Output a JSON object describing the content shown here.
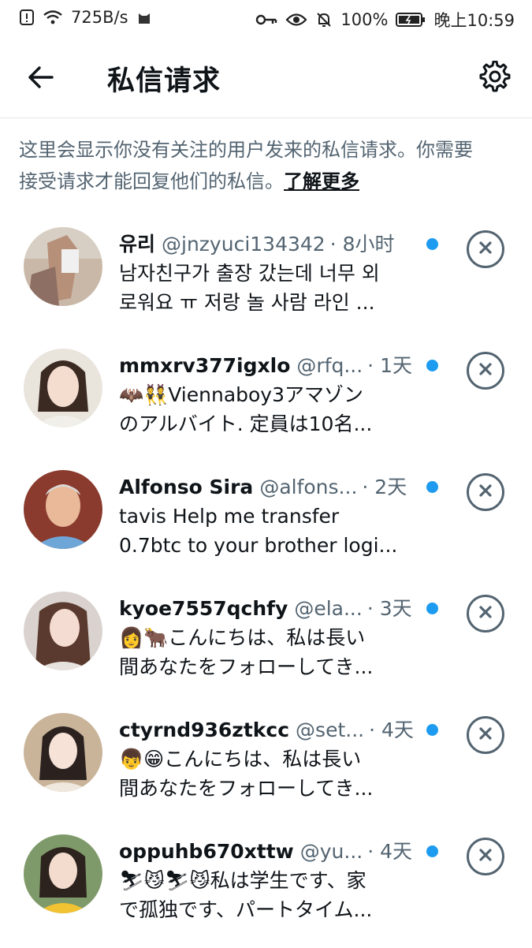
{
  "status_bar": {
    "net_speed": "725B/s",
    "battery": "100%",
    "time": "晚上10:59",
    "icons_left": [
      "alert-icon",
      "wifi-icon",
      "cat-app-icon"
    ],
    "icons_right": [
      "key-icon",
      "eye-icon",
      "mute-bell-icon",
      "battery-icon"
    ]
  },
  "header": {
    "title": "私信请求",
    "back_icon": "arrow-left-icon",
    "settings_icon": "gear-icon"
  },
  "notice": {
    "line1": "这里会显示你没有关注的用户发来的私信请求。你需要",
    "line2_text": "接受请求才能回复他们的私信。",
    "learn_more": "了解更多"
  },
  "colors": {
    "accent": "#1d9bf0",
    "secondary_text": "#536471",
    "primary_text": "#0f1419"
  },
  "requests": [
    {
      "name": "유리",
      "handle": "@jnzyuci134342",
      "time": "· 8小时",
      "line1": "남자친구가 출장 갔는데 너무 외",
      "line2": "로워요 ㅠ 저랑 놀 사람 라인 ...",
      "unread": true
    },
    {
      "name": "mmxrv377igxlo",
      "handle": "@rfq...",
      "time": "· 1天",
      "line1": "🦇👯Viennaboy3アマゾン",
      "line2": "のアルバイト. 定員は10名...",
      "unread": true
    },
    {
      "name": "Alfonso Sira",
      "handle": "@alfons...",
      "time": "· 2天",
      "line1": "tavis Help me transfer",
      "line2": "0.7btc to your brother logi...",
      "unread": true
    },
    {
      "name": "kyoe7557qchfy",
      "handle": "@ela...",
      "time": "· 3天",
      "line1": "👩🐂こんにちは、私は長い",
      "line2": "間あなたをフォローしてき...",
      "unread": true
    },
    {
      "name": "ctyrnd936ztkcc",
      "handle": "@set...",
      "time": "· 4天",
      "line1": "👦😁こんにちは、私は長い",
      "line2": "間あなたをフォローしてき...",
      "unread": true
    },
    {
      "name": "oppuhb670xttw",
      "handle": "@yu...",
      "time": "· 4天",
      "line1": "⛷😼⛷😼私は学生です、家",
      "line2": "で孤独です、パートタイム...",
      "unread": true
    }
  ]
}
